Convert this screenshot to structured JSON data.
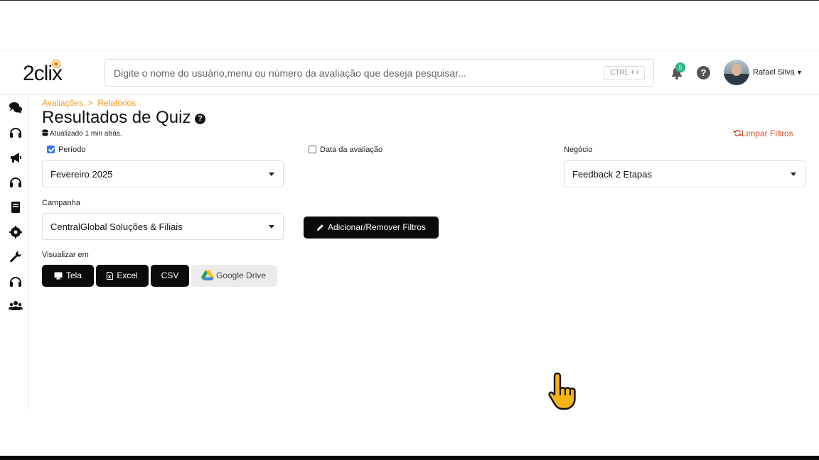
{
  "header": {
    "logo_text": "2clix",
    "search_placeholder": "Digite o nome do usuário,menu ou número da avaliação que deseja pesquisar...",
    "search_shortcut": "CTRL + /",
    "notification_count": "5",
    "help_symbol": "?",
    "user_name": "Rafael Silva"
  },
  "sidebar": {
    "items": [
      {
        "icon": "chat-bubbles-icon"
      },
      {
        "icon": "headset-icon"
      },
      {
        "icon": "megaphone-icon"
      },
      {
        "icon": "headset-icon"
      },
      {
        "icon": "book-icon"
      },
      {
        "icon": "gear-head-icon"
      },
      {
        "icon": "wrench-icon"
      },
      {
        "icon": "headset-icon"
      },
      {
        "icon": "users-icon"
      }
    ]
  },
  "breadcrumb": {
    "first": "Avaliações",
    "separator": ">",
    "second": "Relatórios"
  },
  "page": {
    "title": "Resultados de Quiz",
    "title_help": "?",
    "updated_text": "Atualizado 1 min atrás.",
    "clear_filters": "Limpar Filtros"
  },
  "filters": {
    "period_label": "Período",
    "period_checked": true,
    "period_value": "Fevereiro 2025",
    "date_label": "Data da avaliação",
    "date_checked": false,
    "business_label": "Negócio",
    "business_value": "Feedback 2 Etapas",
    "campaign_label": "Campanha",
    "campaign_value": "CentralGlobal Soluções & Filiais",
    "add_remove_button": "Adicionar/Remover Filtros"
  },
  "view": {
    "label": "Visualizar em",
    "screen_button": "Tela",
    "excel_button": "Excel",
    "csv_button": "CSV",
    "drive_button": "Google Drive"
  },
  "colors": {
    "accent_orange": "#f29a1c",
    "clear_filters": "#c8502a",
    "badge_green": "#2bb38a",
    "button_dark": "#0b0b0b",
    "checkbox_blue": "#3478f6"
  }
}
